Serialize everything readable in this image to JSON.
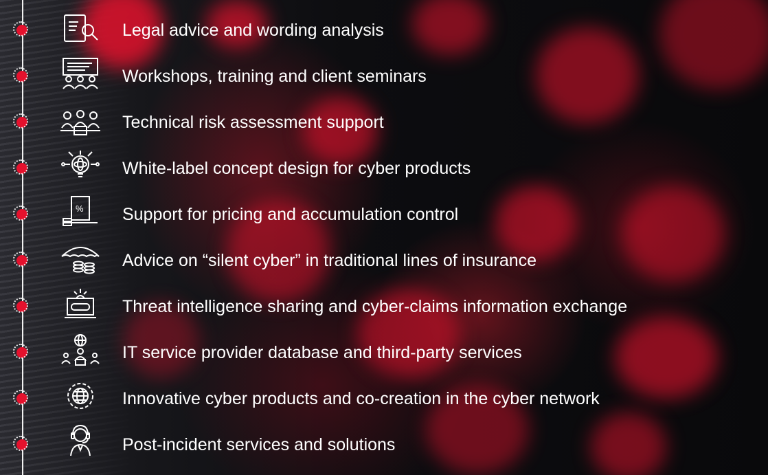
{
  "colors": {
    "accent": "#e5112d",
    "text": "#ffffff",
    "timeline": "#f2f2f2"
  },
  "items": [
    {
      "label": "Legal advice and wording analysis",
      "icon": "document-search-icon"
    },
    {
      "label": "Workshops, training and client seminars",
      "icon": "presentation-audience-icon"
    },
    {
      "label": "Technical risk assessment support",
      "icon": "team-laptop-icon"
    },
    {
      "label": "White-label concept design for cyber products",
      "icon": "lightbulb-atom-icon"
    },
    {
      "label": "Support for pricing and accumulation control",
      "icon": "percent-document-icon"
    },
    {
      "label": "Advice on “silent cyber” in traditional lines of insurance",
      "icon": "umbrella-coins-icon"
    },
    {
      "label": "Threat intelligence sharing and cyber-claims information exchange",
      "icon": "laptop-alert-icon"
    },
    {
      "label": "IT service provider database and third-party services",
      "icon": "network-people-icon"
    },
    {
      "label": "Innovative cyber products and co-creation in the cyber network",
      "icon": "globe-gear-icon"
    },
    {
      "label": "Post-incident services and solutions",
      "icon": "support-agent-icon"
    }
  ]
}
